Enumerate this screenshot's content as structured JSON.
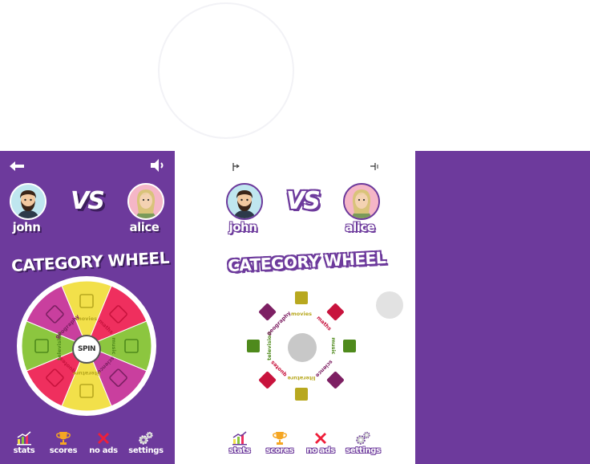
{
  "players": {
    "left": "john",
    "right": "alice"
  },
  "versus": "VS",
  "title": "CATEGORY WHEEL",
  "spin_label": "SPIN",
  "categories": [
    "movies",
    "maths",
    "music",
    "science",
    "literature",
    "quotes",
    "television",
    "geography"
  ],
  "nav": [
    {
      "label": "stats",
      "icon": "bar-chart-icon"
    },
    {
      "label": "scores",
      "icon": "trophy-icon"
    },
    {
      "label": "no ads",
      "icon": "no-ads-icon"
    },
    {
      "label": "settings",
      "icon": "gears-icon"
    }
  ],
  "colors": {
    "background": "#6d3a9c",
    "yellow": "#f2e04a",
    "red": "#ef2f5e",
    "green": "#8cc63f",
    "magenta": "#c93f9e"
  }
}
